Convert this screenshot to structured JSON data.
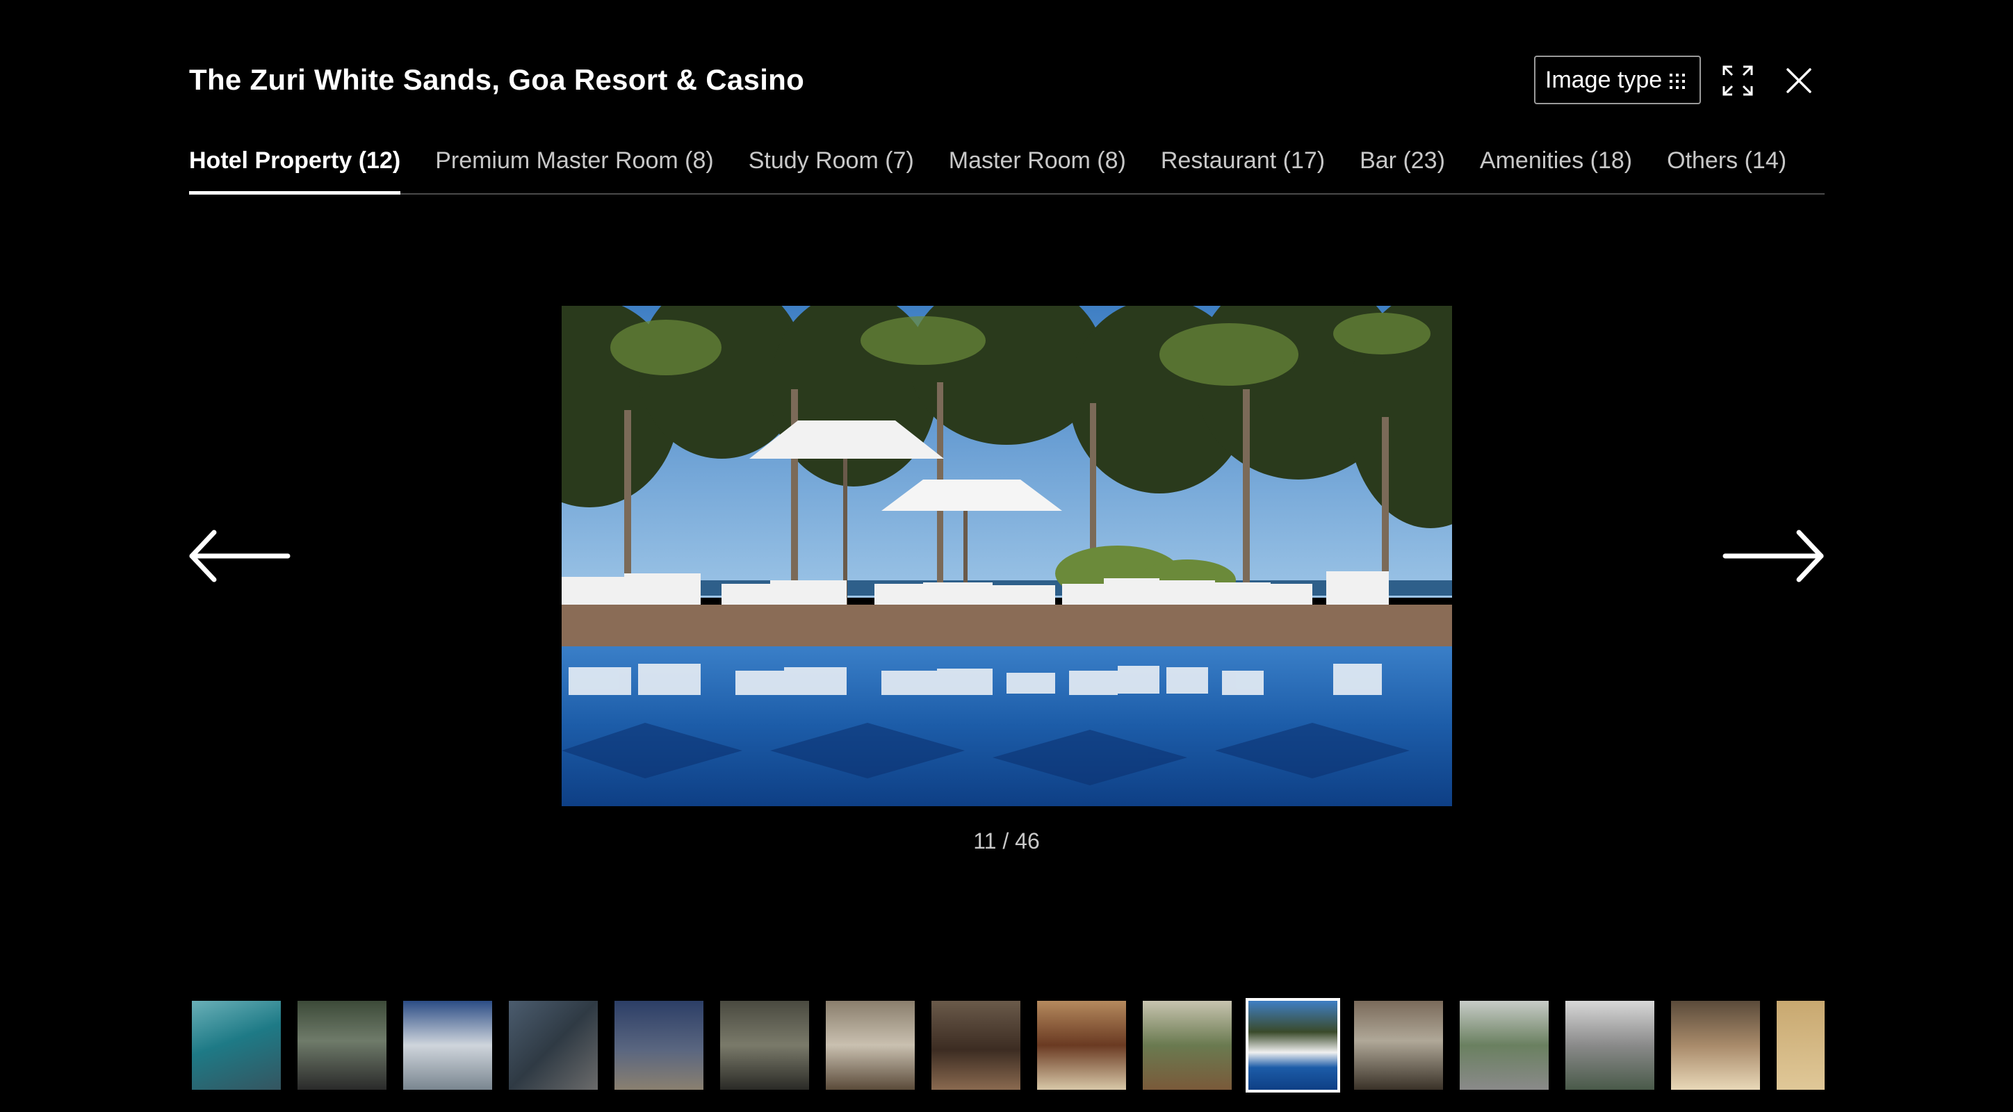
{
  "header": {
    "title": "The Zuri White Sands, Goa Resort & Casino",
    "image_type_label": "Image type"
  },
  "tabs": [
    {
      "label": "Hotel Property (12)",
      "active": true
    },
    {
      "label": "Premium Master Room (8)",
      "active": false
    },
    {
      "label": "Study Room (7)",
      "active": false
    },
    {
      "label": "Master Room (8)",
      "active": false
    },
    {
      "label": "Restaurant (17)",
      "active": false
    },
    {
      "label": "Bar (23)",
      "active": false
    },
    {
      "label": "Amenities (18)",
      "active": false
    },
    {
      "label": "Others (14)",
      "active": false
    }
  ],
  "viewer": {
    "counter": "11 / 46",
    "current_index": 11,
    "total": 46
  },
  "icons": {
    "expand": "expand-icon",
    "close": "close-icon",
    "grid": "grid-icon",
    "prev": "arrow-left-icon",
    "next": "arrow-right-icon"
  },
  "colors": {
    "background": "#000000",
    "text": "#ffffff",
    "muted_text": "#c8c8c8",
    "tab_divider": "#4a4a4a",
    "active_indicator": "#ffffff"
  }
}
